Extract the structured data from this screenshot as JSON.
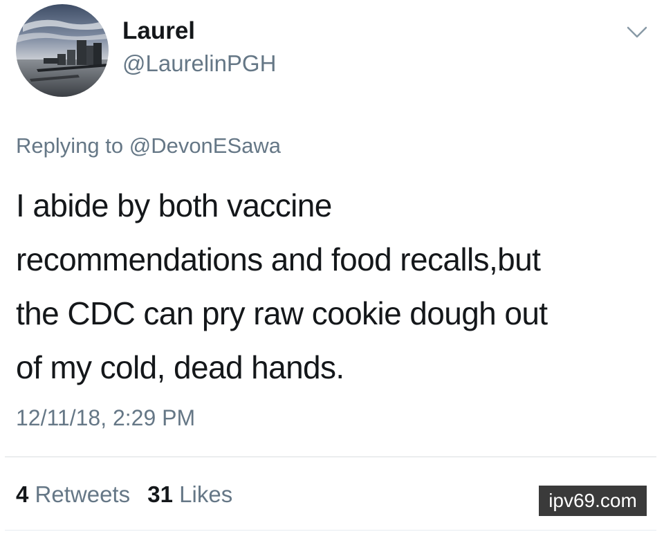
{
  "user": {
    "display_name": "Laurel",
    "handle": "@LaurelinPGH"
  },
  "reply": {
    "prefix": "Replying to",
    "mention": "@DevonESawa"
  },
  "tweet": {
    "lines": [
      "I abide by both vaccine",
      "recommendations and food recalls,but",
      "the CDC can pry raw cookie dough out",
      "of my cold, dead hands."
    ],
    "timestamp": "12/11/18, 2:29 PM"
  },
  "stats": {
    "retweets_count": "4",
    "retweets_label": "Retweets",
    "likes_count": "31",
    "likes_label": "Likes"
  },
  "watermark": "ipv69.com",
  "icons": {
    "menu": "chevron-down-icon"
  }
}
